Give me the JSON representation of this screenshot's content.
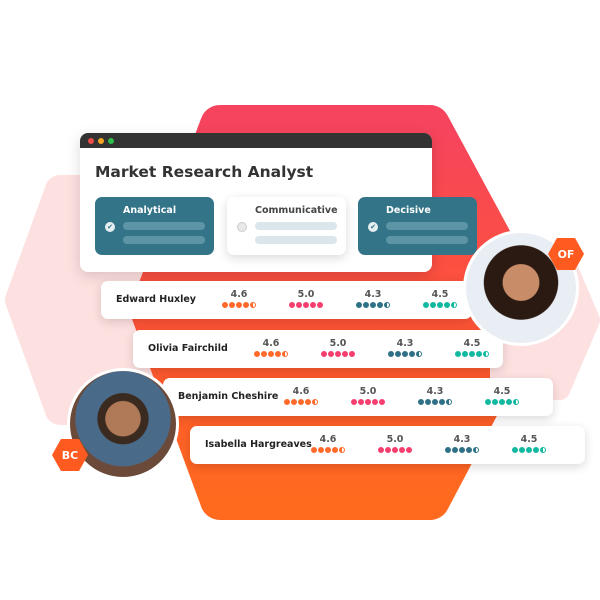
{
  "window": {
    "title": "Market Research Analyst",
    "traffic_lights": [
      "#ee4b4b",
      "#f5a623",
      "#2dbf4e"
    ]
  },
  "traits": [
    {
      "label": "Analytical",
      "selected": true
    },
    {
      "label": "Communicative",
      "selected": false
    },
    {
      "label": "Decisive",
      "selected": true
    }
  ],
  "colors": {
    "c1": "#ff6a2a",
    "c2": "#f43f6e",
    "c3": "#2f7186",
    "c4": "#12b8a0"
  },
  "candidates": [
    {
      "name": "Edward Huxley",
      "scores": [
        "4.6",
        "5.0",
        "4.3",
        "4.5"
      ]
    },
    {
      "name": "Olivia Fairchild",
      "scores": [
        "4.6",
        "5.0",
        "4.3",
        "4.5"
      ]
    },
    {
      "name": "Benjamin Cheshire",
      "scores": [
        "4.6",
        "5.0",
        "4.3",
        "4.5"
      ]
    },
    {
      "name": "Isabella Hargreaves",
      "scores": [
        "4.6",
        "5.0",
        "4.3",
        "4.5"
      ]
    }
  ],
  "avatars": {
    "of": "OF",
    "bc": "BC"
  }
}
